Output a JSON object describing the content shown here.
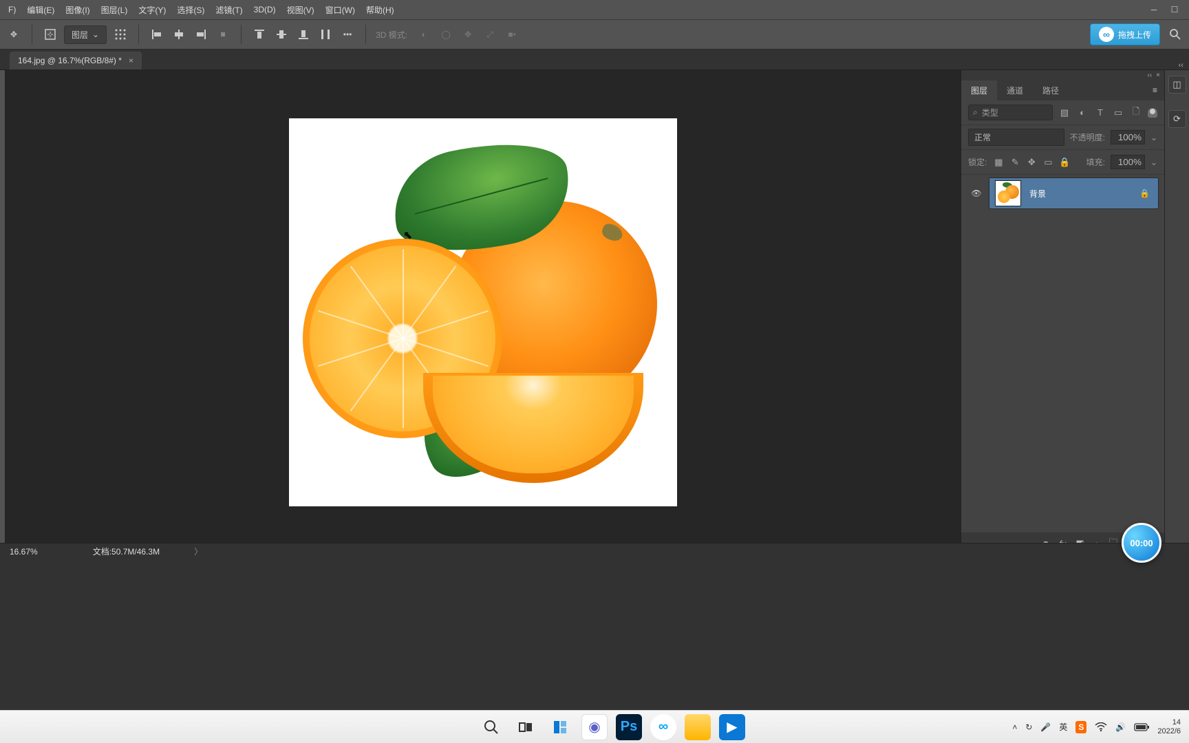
{
  "menubar": {
    "items": [
      "F)",
      "编辑(E)",
      "图像(I)",
      "图层(L)",
      "文字(Y)",
      "选择(S)",
      "滤镜(T)",
      "3D(D)",
      "视图(V)",
      "窗口(W)",
      "帮助(H)"
    ]
  },
  "optionsbar": {
    "layer_label": "图层",
    "mode3d_label": "3D 模式:",
    "upload_label": "拖拽上传"
  },
  "document": {
    "tab_title": "164.jpg @ 16.7%(RGB/8#) *"
  },
  "layers_panel": {
    "tabs": [
      "图层",
      "通道",
      "路径"
    ],
    "search_placeholder": "类型",
    "blend_mode": "正常",
    "opacity_label": "不透明度:",
    "opacity_value": "100%",
    "lock_label": "锁定:",
    "fill_label": "填充:",
    "fill_value": "100%",
    "layer_name": "背景"
  },
  "statusbar": {
    "zoom": "16.67%",
    "doc_info": "文档:50.7M/46.3M"
  },
  "taskbar": {
    "time": "14",
    "date": "2022/6",
    "ime": "英"
  },
  "recorder": {
    "time": "00:00"
  }
}
